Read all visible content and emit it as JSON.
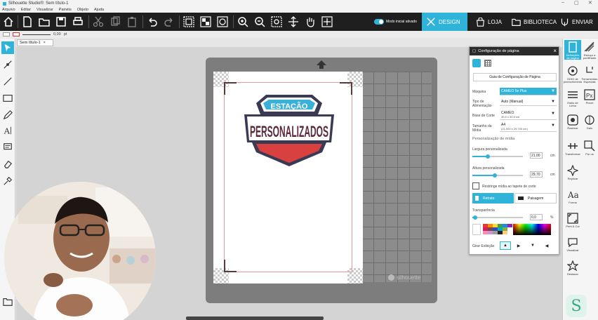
{
  "window": {
    "title": "Silhouette Studio®: Sem título-1"
  },
  "menu": [
    "Arquivo",
    "Editar",
    "Visualizar",
    "Painéis",
    "Objeto",
    "Ajuda"
  ],
  "toolbar": {
    "modo_label": "Modo inicial ativado",
    "design": "DESIGN",
    "loja": "LOJA",
    "biblioteca": "BIBLIOTECA",
    "enviar": "ENVIAR"
  },
  "linebar": {
    "stroke_value": "0,00",
    "unit": "pt"
  },
  "document": {
    "tab_label": "Sem título-1",
    "close": "×"
  },
  "logo": {
    "line1": "ESTAÇÃO",
    "line2": "PERSONALIZADOS"
  },
  "brand": "silhouette",
  "panel": {
    "title": "Configuração de página",
    "guide_button": "Guia de Configuração de Página",
    "maquina_label": "Máquina",
    "maquina_value": "CAMEO 5e Plus",
    "alimentacao_label": "Tipo de Alimentação",
    "alimentacao_value": "Auto (Manual)",
    "base_label": "Base de Corte",
    "base_value": "CAMEO",
    "base_sub": "30,5 x 30,5 cm",
    "tamanho_label": "Tamanho da Mídia",
    "tamanho_value": "A4",
    "tamanho_sub": "(21,000 x 29,700 cm)",
    "section": "Personalização de mídia",
    "largura_label": "Largura personalizada",
    "largura_value": "21,00",
    "altura_label": "Altura personalizada",
    "altura_value": "29,70",
    "unit": "cm",
    "largura_level": 0.3,
    "altura_level": 0.45,
    "restringe_label": "Restringe mídia ao tapete de corte",
    "retrato": "Retrato",
    "paisagem": "Paisagem",
    "transparencia_label": "Transparência",
    "transparencia_value": "0,0",
    "pct": "%",
    "transparencia_level": 0.05,
    "girar_label": "Girar Exibição"
  },
  "righttools": [
    "Definições da página",
    "Esboço a pontilhado",
    "DDIO de preenchimento",
    "Ferramentas Especiais",
    "Estilo de Linha",
    "Pixcel",
    "Rastrear",
    "Dalo",
    "Transformar",
    "Por us",
    "Replicar",
    "Forma",
    "Print & Cut",
    "Visualizar",
    "Destacar"
  ],
  "colors": {
    "toolbar": "#1f1f1f",
    "accent": "#2fb3d9",
    "mat": "#7d7d7d"
  }
}
